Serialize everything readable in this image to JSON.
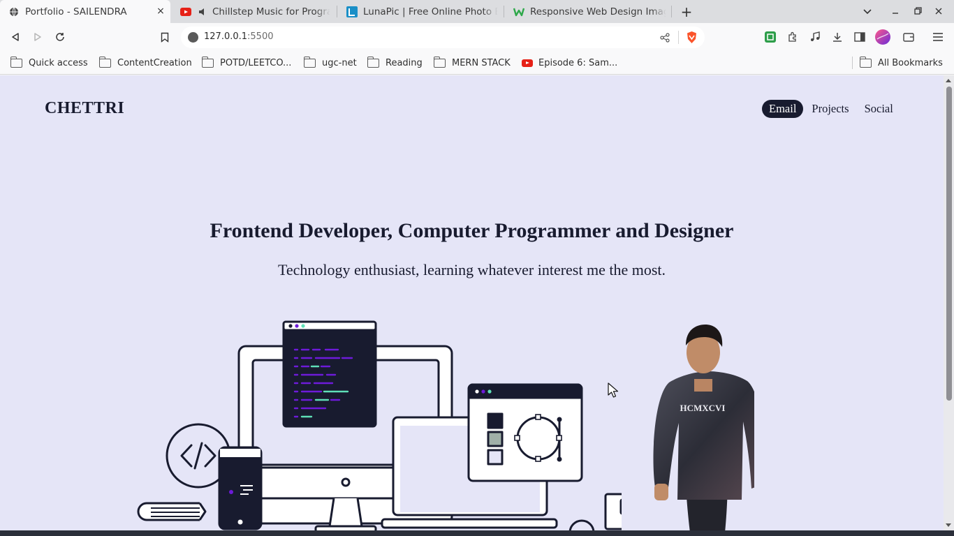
{
  "browser": {
    "tabs": [
      {
        "title": "Portfolio - SAILENDRA",
        "icon": "globe-icon",
        "active": true
      },
      {
        "title": "Chillstep Music for Programming",
        "icon": "youtube-icon",
        "audio": true
      },
      {
        "title": "LunaPic | Free Online Photo Editor",
        "icon": "lunapic-icon"
      },
      {
        "title": "Responsive Web Design Images",
        "icon": "w-logo-icon"
      }
    ],
    "close_glyph": "×",
    "new_tab_glyph": "+",
    "address": {
      "host": "127.0.0.1",
      "port": ":5500"
    },
    "bookmarks": [
      {
        "label": "Quick access",
        "icon": "folder-icon"
      },
      {
        "label": "ContentCreation",
        "icon": "folder-icon"
      },
      {
        "label": "POTD/LEETCO...",
        "icon": "folder-icon"
      },
      {
        "label": "ugc-net",
        "icon": "folder-icon"
      },
      {
        "label": "Reading",
        "icon": "folder-icon"
      },
      {
        "label": "MERN STACK",
        "icon": "folder-icon"
      },
      {
        "label": "Episode 6: Sam...",
        "icon": "youtube-icon"
      }
    ],
    "all_bookmarks": "All Bookmarks"
  },
  "page": {
    "logo": "CHETTRI",
    "nav": [
      {
        "label": "Email",
        "active": true
      },
      {
        "label": "Projects"
      },
      {
        "label": "Social"
      }
    ],
    "hero_title": "Frontend Developer, Computer Programmer and Designer",
    "hero_subtitle": "Technology enthusiast, learning whatever interest me the most.",
    "portrait_print": "HCMXCVI"
  },
  "colors": {
    "page_bg": "#e5e5f7",
    "ink": "#181b2f",
    "accent_purple": "#6d1bd9",
    "accent_green": "#5fe0b8"
  }
}
